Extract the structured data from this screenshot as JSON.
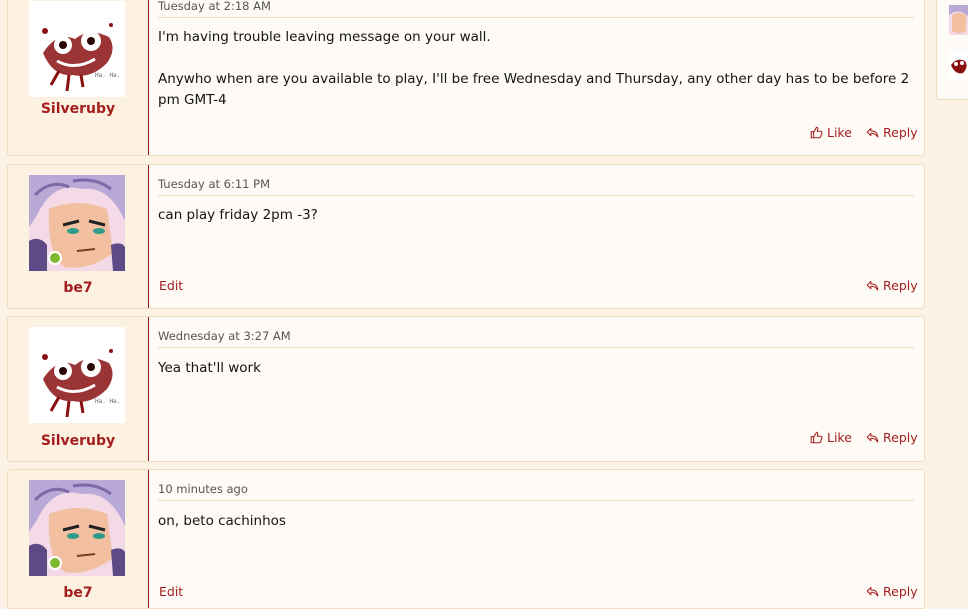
{
  "posts": [
    {
      "username": "Silveruby",
      "timestamp": "Tuesday at 2:18 AM",
      "paragraphs": [
        "I'm having trouble leaving message on your wall.",
        "Anywho when are you available to play, I'll be free Wednesday and Thursday, any other day has to be before 2 pm GMT-4"
      ],
      "like_label": "Like",
      "reply_label": "Reply"
    },
    {
      "username": "be7",
      "timestamp": "Tuesday at 6:11 PM",
      "paragraphs": [
        "can play friday 2pm -3?"
      ],
      "edit_label": "Edit",
      "reply_label": "Reply"
    },
    {
      "username": "Silveruby",
      "timestamp": "Wednesday at 3:27 AM",
      "paragraphs": [
        "Yea that'll work"
      ],
      "like_label": "Like",
      "reply_label": "Reply"
    },
    {
      "username": "be7",
      "timestamp": "10 minutes ago",
      "paragraphs": [
        "on, beto cachinhos"
      ],
      "edit_label": "Edit",
      "reply_label": "Reply"
    }
  ],
  "colors": {
    "page_bg": "#fcf3e6",
    "card_bg": "#fefbf7",
    "user_panel_bg": "#fdf1e2",
    "accent": "#a51e1e",
    "online_dot": "#7fb82e"
  },
  "icons": [
    "thumbs-up-icon",
    "reply-icon",
    "online-status-icon"
  ]
}
